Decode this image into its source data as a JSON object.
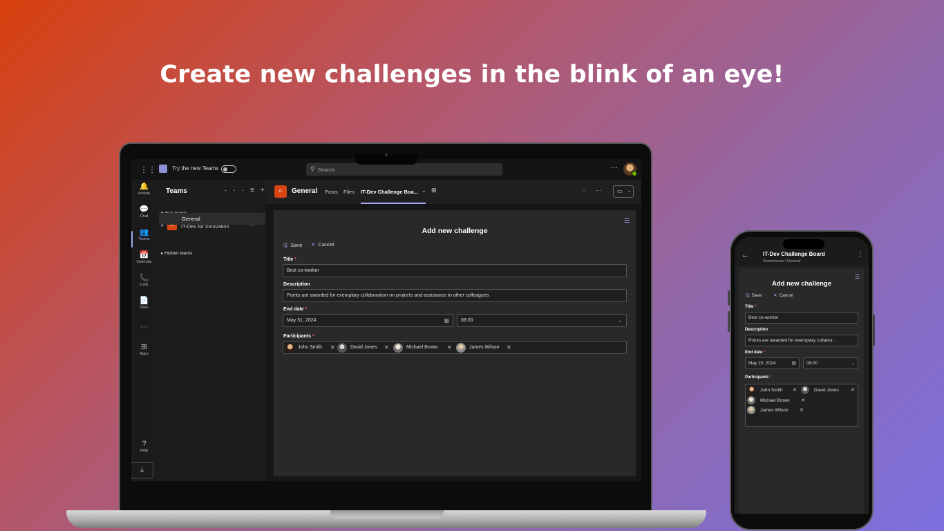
{
  "headline": "Create new challenges in the blink of an eye!",
  "colors": {
    "accent": "#a6aaf0",
    "required": "#e5666a",
    "team_icon": "#d84515",
    "presence": "#6bb700"
  },
  "laptop": {
    "titlebar": {
      "try_new_label": "Try the new Teams",
      "search_placeholder": "Search",
      "more": "···",
      "icons": [
        "app-launcher-icon",
        "teams-logo-icon",
        "search-icon",
        "avatar"
      ]
    },
    "rail": [
      {
        "label": "Activity",
        "icon": "bell-icon",
        "glyph": "🔔"
      },
      {
        "label": "Chat",
        "icon": "chat-icon",
        "glyph": "💬"
      },
      {
        "label": "Teams",
        "icon": "teams-icon",
        "glyph": "👥",
        "active": true
      },
      {
        "label": "Calendar",
        "icon": "calendar-icon",
        "glyph": "📅"
      },
      {
        "label": "Calls",
        "icon": "phone-icon",
        "glyph": "📞"
      },
      {
        "label": "Files",
        "icon": "file-icon",
        "glyph": "📄"
      },
      {
        "label": "",
        "icon": "more-icon",
        "glyph": "···"
      },
      {
        "label": "Apps",
        "icon": "apps-icon",
        "glyph": "⊞"
      },
      {
        "label": "Help",
        "icon": "help-icon",
        "glyph": "?"
      }
    ],
    "teams_pane": {
      "title": "Teams",
      "your_teams": "Your teams",
      "team_name": "IT-Dev for Innovation",
      "team_icon_text": "G",
      "channel": "General",
      "hidden_teams": "Hidden teams"
    },
    "channel_header": {
      "icon_text": "G",
      "name": "General",
      "tabs": [
        "Posts",
        "Files",
        "IT-Dev Challenge Boa..."
      ],
      "active_tab": "IT-Dev Challenge Boa..."
    },
    "form": {
      "title": "Add new challenge",
      "save": "Save",
      "cancel": "Cancel",
      "title_label": "Title",
      "title_value": "Best co-worker",
      "description_label": "Description",
      "description_value": "Points are awarded for exemplary collaboration on projects and assistance to other colleagues",
      "end_date_label": "End date",
      "date_value": "May 31, 2024",
      "time_value": "08:00",
      "participants_label": "Participants",
      "participants": [
        "John Smith",
        "David Jones",
        "Michael Brown",
        "James Wilson"
      ]
    }
  },
  "phone": {
    "header": {
      "title": "IT-Dev Challenge Board",
      "subtitle": "Greenhouse / General"
    },
    "form": {
      "title": "Add new challenge",
      "save": "Save",
      "cancel": "Cancel",
      "title_label": "Title",
      "title_value": "Best co-worker",
      "description_label": "Description",
      "description_value": "Points are awarded for exemplary collabor...",
      "end_date_label": "End date",
      "date_value": "May 20, 2024",
      "time_value": "08:00",
      "participants_label": "Participants",
      "participants": [
        "John Smith",
        "David Jones",
        "Michael Brown",
        "James Wilson"
      ]
    }
  }
}
